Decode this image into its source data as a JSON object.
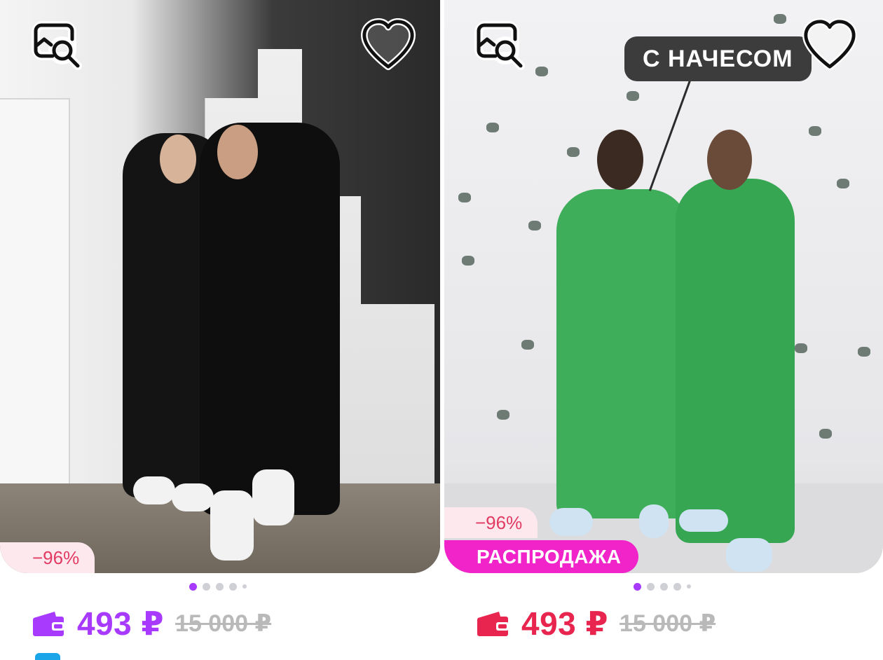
{
  "cards": [
    {
      "discount": "−96%",
      "price": "493 ₽",
      "old_price": "15 000 ₽",
      "accent_color": "#a73afd",
      "photo_count": 5,
      "active_photo": 1,
      "favorite": false,
      "icons": {
        "search": "image-search-icon",
        "favorite": "heart-outline-icon",
        "wallet": "wallet-icon"
      }
    },
    {
      "callout": "С НАЧЕСОМ",
      "discount": "−96%",
      "sale_badge": "РАСПРОДАЖА",
      "price": "493 ₽",
      "old_price": "15 000 ₽",
      "accent_color": "#e8254f",
      "sale_color": "#f024c8",
      "photo_count": 5,
      "active_photo": 1,
      "favorite": false,
      "icons": {
        "search": "image-search-icon",
        "favorite": "heart-outline-icon",
        "wallet": "wallet-icon"
      }
    }
  ]
}
